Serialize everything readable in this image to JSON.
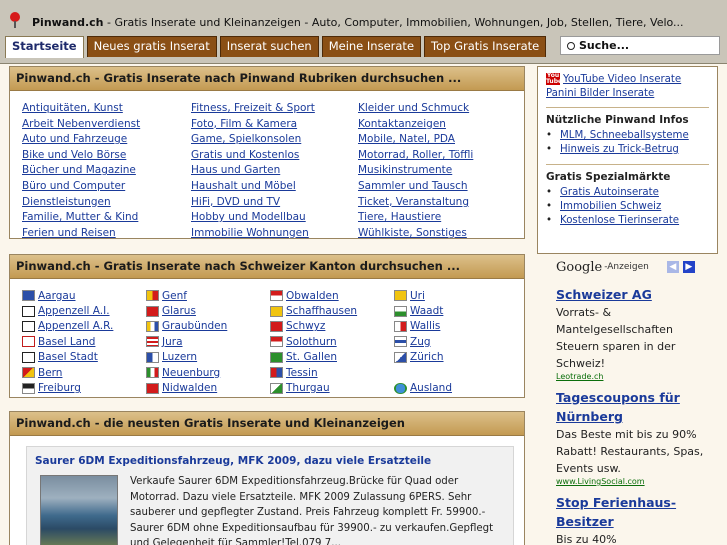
{
  "header": {
    "site_name": "Pinwand.ch",
    "tagline": " - Gratis Inserate und Kleinanzeigen - Auto, Computer, Immobilien, Wohnungen, Job, Stellen, Tiere, Velo...",
    "tabs": [
      "Startseite",
      "Neues gratis Inserat",
      "Inserat suchen",
      "Meine Inserate",
      "Top Gratis Inserate"
    ],
    "search_label": "Suche..."
  },
  "rubriken": {
    "title": "Pinwand.ch - Gratis Inserate nach Pinwand Rubriken durchsuchen ...",
    "col1": [
      "Antiquitäten, Kunst",
      "Arbeit Nebenverdienst",
      "Auto und Fahrzeuge",
      "Bike und Velo Börse",
      "Bücher und Magazine",
      "Büro und Computer",
      "Dienstleistungen",
      "Familie, Mutter & Kind",
      "Ferien und Reisen"
    ],
    "col2": [
      "Fitness, Freizeit & Sport",
      "Foto, Film & Kamera",
      "Game, Spielkonsolen",
      "Gratis und Kostenlos",
      "Haus und Garten",
      "Haushalt und Möbel",
      "HiFi, DVD und TV",
      "Hobby und Modellbau",
      "Immobilie Wohnungen"
    ],
    "col3": [
      "Kleider und Schmuck",
      "Kontaktanzeigen",
      "Mobile, Natel, PDA",
      "Motorrad, Roller, Töffli",
      "Musikinstrumente",
      "Sammler und Tausch",
      "Ticket, Veranstaltung",
      "Tiere, Haustiere",
      "Wühlkiste, Sonstiges"
    ]
  },
  "kanton": {
    "title": "Pinwand.ch - Gratis Inserate nach Schweizer Kanton durchsuchen ...",
    "col1": [
      "Aargau",
      "Appenzell A.I.",
      "Appenzell A.R.",
      "Basel Land",
      "Basel Stadt",
      "Bern",
      "Freiburg"
    ],
    "col2": [
      "Genf",
      "Glarus",
      "Graubünden",
      "Jura",
      "Luzern",
      "Neuenburg",
      "Nidwalden"
    ],
    "col3": [
      "Obwalden",
      "Schaffhausen",
      "Schwyz",
      "Solothurn",
      "St. Gallen",
      "Tessin",
      "Thurgau"
    ],
    "col4": [
      "Uri",
      "Waadt",
      "Wallis",
      "Zug",
      "Zürich",
      "",
      "Ausland"
    ]
  },
  "neu": {
    "title": "Pinwand.ch - die neusten Gratis Inserate und Kleinanzeigen",
    "item_title": "Saurer 6DM Expeditionsfahrzeug, MFK 2009, dazu viele Ersatzteile",
    "item_text": "Verkaufe Saurer 6DM Expeditionsfahrzeug.Brücke für Quad oder Motorrad. Dazu viele Ersatzteile. MFK 2009 Zulassung 6PERS. Sehr sauberer und gepflegter Zustand. Preis Fahrzeug komplett Fr. 59900.- Saurer 6DM ohne Expeditionsaufbau für 39900.- zu verkaufen.Gepflegt und Gelegenheit für Sammler!Tel.079 7..."
  },
  "sidebar": {
    "youtube_link": "YouTube Video Inserate Panini Bilder Inserate",
    "infos_title": "Nützliche Pinwand Infos",
    "infos": [
      "MLM, Schneeballsysteme",
      "Hinweis zu Trick-Betrug"
    ],
    "maerkte_title": "Gratis Spezialmärkte",
    "maerkte": [
      "Gratis Autoinserate",
      "Immobilien Schweiz",
      "Kostenlose Tierinserate"
    ]
  },
  "ads": {
    "google": "Google",
    "label": "-Anzeigen",
    "items": [
      {
        "title": "Schweizer AG",
        "body": "Vorrats- & Mantelgesellschaften Steuern sparen in der Schweiz!",
        "url": "Leotrade.ch"
      },
      {
        "title": "Tagescoupons für Nürnberg",
        "body": "Das Beste mit bis zu 90% Rabatt! Restaurants, Spas, Events usw.",
        "url": "www.LivingSocial.com"
      },
      {
        "title": "Stop Ferienhaus-Besitzer",
        "body": "Bis zu 40%",
        "url": ""
      }
    ]
  }
}
